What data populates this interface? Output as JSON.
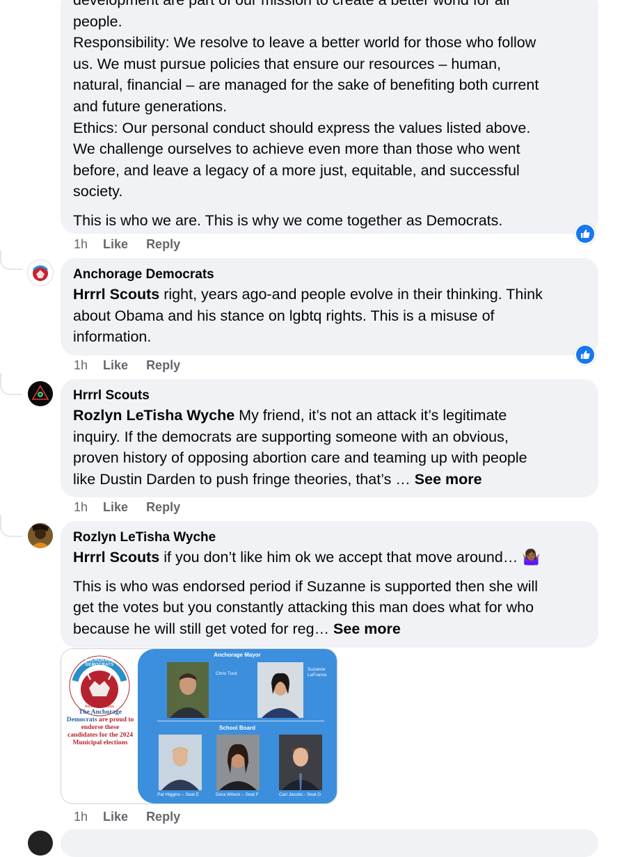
{
  "comment1": {
    "partial_line": "development are part of our mission to create a better world for all",
    "lines": [
      "people.",
      "Responsibility: We resolve to leave a better world for those who follow",
      "us. We must pursue policies that ensure our resources – human,",
      "natural, financial – are managed for the sake of benefiting both current",
      "and future generations.",
      "Ethics: Our personal conduct should express the values listed above.",
      "We challenge ourselves to achieve even more than those who went",
      "before, and leave a legacy of a more just, equitable, and successful",
      "society."
    ],
    "closing": "This is who we are. This is why we come together as Democrats.",
    "time": "1h",
    "like": "Like",
    "reply": "Reply"
  },
  "comment2": {
    "author": "Anchorage Democrats",
    "mention": "Hrrrl Scouts",
    "line1_rest": " right, years ago-and people evolve in their thinking. Think",
    "line2": "about Obama and his stance on lgbtq rights. This is a misuse of",
    "line3": "information.",
    "time": "1h",
    "like": "Like",
    "reply": "Reply"
  },
  "comment3": {
    "author": "Hrrrl Scouts",
    "mention": "Rozlyn LeTisha Wyche",
    "line1_rest": " My friend, it’s not an attack it’s legitimate",
    "line2": "inquiry. If the democrats are supporting someone with an obvious,",
    "line3": "proven history of opposing abortion care and teaming up with people",
    "line4": "like Dustin Darden to push fringe theories, that’s … ",
    "see_more": "See more",
    "time": "1h",
    "like": "Like",
    "reply": "Reply"
  },
  "comment4": {
    "author": "Rozlyn LeTisha Wyche",
    "mention": "Hrrrl Scouts",
    "line1_rest": " if you don’t like him ok we accept that move around… 🤷🏾‍♀️",
    "para2_line1": "This is who was endorsed period if Suzanne is supported then she will",
    "para2_line2": "get the votes but you constantly attacking this man does what for who",
    "para2_line3": "because he will still get voted for reg… ",
    "see_more": "See more",
    "time": "1h",
    "like": "Like",
    "reply": "Reply"
  },
  "endorsement_image": {
    "logo_text_top": "ANCHORAGE DEMOCRATS",
    "logo_text_bottom": "Anchorage, Alaska",
    "left_text_1": "The Anchorage",
    "left_text_2": "Democrats",
    "left_text_3": " are proud to endorse these candidates for the 2024 Municipal elections",
    "mayor_title": "Anchorage Mayor",
    "mayor_1": "Chris Tuck",
    "mayor_2_line1": "Suzanne",
    "mayor_2_line2": "LaFrance",
    "school_title": "School Board",
    "board_1": "Pat Higgins – Seat E",
    "board_2": "Dora Wilson – Seat F",
    "board_3": "Carl Jacobs - Seat G"
  },
  "colors": {
    "bubble": "#f0f2f5",
    "meta": "#65676b",
    "like_blue": "#1877f2",
    "card_blue": "#3c8fdc"
  }
}
